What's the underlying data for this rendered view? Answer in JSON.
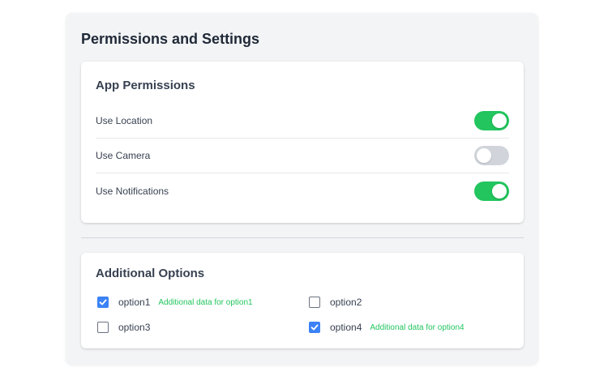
{
  "page": {
    "title": "Permissions and Settings"
  },
  "permissions": {
    "title": "App Permissions",
    "items": [
      {
        "label": "Use Location",
        "enabled": true
      },
      {
        "label": "Use Camera",
        "enabled": false
      },
      {
        "label": "Use Notifications",
        "enabled": true
      }
    ]
  },
  "options": {
    "title": "Additional Options",
    "items": [
      {
        "label": "option1",
        "checked": true,
        "extra": "Additional data for option1"
      },
      {
        "label": "option2",
        "checked": false,
        "extra": ""
      },
      {
        "label": "option3",
        "checked": false,
        "extra": ""
      },
      {
        "label": "option4",
        "checked": true,
        "extra": "Additional data for option4"
      }
    ]
  },
  "colors": {
    "toggle_on": "#22c55e",
    "toggle_off": "#d1d5db",
    "checkbox_checked": "#3b82f6",
    "extra_text": "#22c55e"
  }
}
